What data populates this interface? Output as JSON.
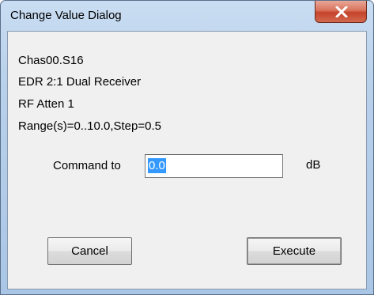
{
  "window": {
    "title": "Change Value Dialog",
    "close_icon": "close-icon"
  },
  "info": {
    "line1": "Chas00.S16",
    "line2": "EDR 2:1 Dual Receiver",
    "line3": "RF Atten 1",
    "line4": "Range(s)=0..10.0,Step=0.5"
  },
  "command": {
    "label": "Command to",
    "value": "0.0",
    "unit": "dB"
  },
  "buttons": {
    "cancel_label": "Cancel",
    "execute_label": "Execute"
  },
  "colors": {
    "selection": "#3399ff",
    "close_button": "#c4432a",
    "frame": "#b8d0ea"
  }
}
